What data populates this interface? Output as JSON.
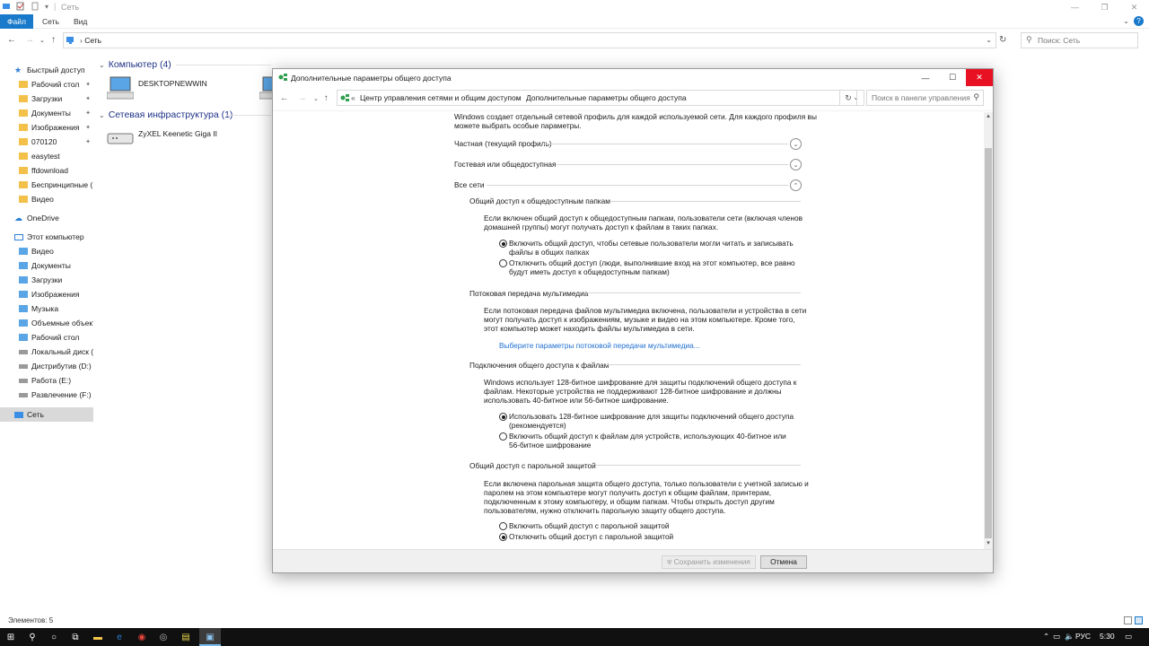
{
  "explorer": {
    "title": "Сеть",
    "ribbon_tabs": [
      "Файл",
      "Сеть",
      "Вид"
    ],
    "address": {
      "crumb": "Сеть"
    },
    "search_placeholder": "Поиск: Сеть",
    "nav": {
      "quick_access": "Быстрый доступ",
      "quick_items": [
        {
          "label": "Рабочий стол",
          "pinned": true
        },
        {
          "label": "Загрузки",
          "pinned": true
        },
        {
          "label": "Документы",
          "pinned": true
        },
        {
          "label": "Изображения",
          "pinned": true
        },
        {
          "label": "070120",
          "pinned": true
        },
        {
          "label": "easytest",
          "pinned": false
        },
        {
          "label": "ffdownload",
          "pinned": false
        },
        {
          "label": "Беспринципные (1",
          "pinned": false
        },
        {
          "label": "Видео",
          "pinned": false
        }
      ],
      "onedrive": "OneDrive",
      "this_pc": "Этот компьютер",
      "pc_items": [
        "Видео",
        "Документы",
        "Загрузки",
        "Изображения",
        "Музыка",
        "Объемные объект",
        "Рабочий стол",
        "Локальный диск (C",
        "Дистрибутив (D:)",
        "Работа (E:)",
        "Развлечение (F:)"
      ],
      "network": "Сеть"
    },
    "groups": {
      "computers": "Компьютер (4)",
      "computer_item": "DESKTOPNEWWIN",
      "infrastructure": "Сетевая инфраструктура (1)",
      "infra_item": "ZyXEL Keenetic Giga II"
    },
    "status": "Элементов: 5"
  },
  "dialog": {
    "title": "Дополнительные параметры общего доступа",
    "crumb1": "Центр управления сетями и общим доступом",
    "crumb_sep": "›",
    "crumb2": "Дополнительные параметры общего доступа",
    "search_placeholder": "Поиск в панели управления",
    "intro": [
      "Windows создает отдельный сетевой профиль для каждой используемой сети. Для каждого профиля вы",
      "можете выбрать особые параметры."
    ],
    "profiles": [
      "Частная (текущий профиль)",
      "Гостевая или общедоступная",
      "Все сети"
    ],
    "public_folders": {
      "heading": "Общий доступ к общедоступным папкам",
      "desc": [
        "Если включен общий доступ к общедоступным папкам, пользователи сети (включая членов",
        "домашней группы) могут получать доступ к файлам в таких папках."
      ],
      "opt1": [
        "Включить общий доступ, чтобы сетевые пользователи могли читать и записывать",
        "файлы в общих папках"
      ],
      "opt2": [
        "Отключить общий доступ (люди, выполнившие вход на этот компьютер, все равно",
        "будут иметь доступ к общедоступным папкам)"
      ],
      "selected": 1
    },
    "streaming": {
      "heading": "Потоковая передача мультимедиа",
      "desc": [
        "Если потоковая передача файлов мультимедиа включена, пользователи и устройства в сети",
        "могут получать доступ к изображениям, музыке и видео на этом компьютере. Кроме того,",
        "этот компьютер может находить файлы мультимедиа в сети."
      ],
      "link": "Выберите параметры потоковой передачи мультимедиа..."
    },
    "file_sharing": {
      "heading": "Подключения общего доступа к файлам",
      "desc": [
        "Windows использует 128-битное шифрование для защиты подключений общего доступа к",
        "файлам. Некоторые устройства не поддерживают 128-битное шифрование и должны",
        "использовать 40-битное или 56-битное шифрование."
      ],
      "opt1": [
        "Использовать 128-битное шифрование для защиты подключений общего доступа",
        "(рекомендуется)"
      ],
      "opt2": [
        "Включить общий доступ к файлам для устройств, использующих 40-битное или",
        "56-битное шифрование"
      ],
      "selected": 1
    },
    "password": {
      "heading": "Общий доступ с парольной защитой",
      "desc": [
        "Если включена парольная защита общего доступа, только пользователи с учетной записью и",
        "паролем на этом компьютере могут получить доступ к общим файлам, принтерам,",
        "подключенным к этому компьютеру, и общим папкам. Чтобы открыть доступ другим",
        "пользователям, нужно отключить парольную защиту общего доступа."
      ],
      "opt1": "Включить общий доступ с парольной защитой",
      "opt2": "Отключить общий доступ с парольной защитой",
      "selected": 2
    },
    "save_button": "Сохранить изменения",
    "cancel_button": "Отмена"
  },
  "taskbar": {
    "language": "РУС",
    "time": "5:30"
  },
  "colors": {
    "accent": "#1979ca",
    "close_red": "#e81123",
    "link": "#1f6fd0",
    "group_header": "#1e3287"
  }
}
